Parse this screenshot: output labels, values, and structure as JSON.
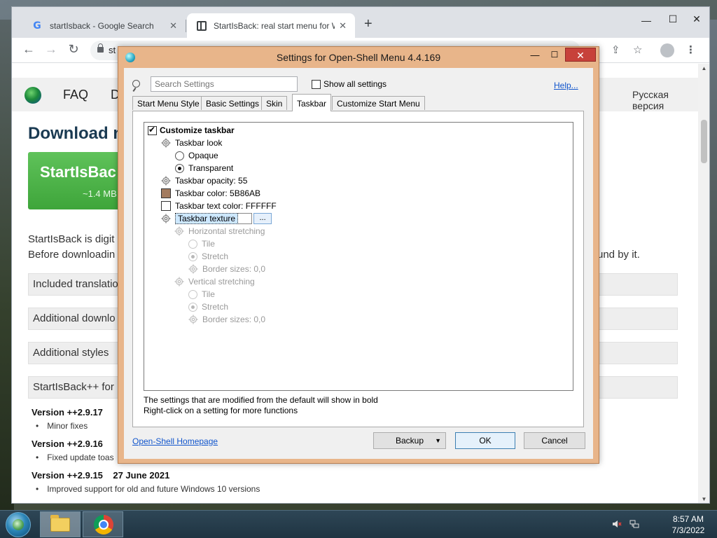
{
  "browser": {
    "tabs": [
      {
        "title": "startIsback - Google Search",
        "icon": "google-icon"
      },
      {
        "title": "StartIsBack: real start menu for W",
        "icon": "document-icon"
      }
    ],
    "omnibox_text": "st"
  },
  "website": {
    "nav_faq": "FAQ",
    "nav_d": "D",
    "language_link": "Русская версия",
    "heading": "Download n",
    "download_name": "StartIsBac",
    "download_size": "~1.4 MB",
    "para1": "StartIsBack is digit",
    "para2": "Before downloadin",
    "para2_tail": "und by it.",
    "accordions": [
      "Included translatio",
      "Additional downlo",
      "Additional styles",
      "StartIsBack++ for"
    ],
    "versions": [
      {
        "version": "Version ++2.9.17",
        "note": "Minor fixes"
      },
      {
        "version": "Version ++2.9.16",
        "note": "Fixed update toas"
      },
      {
        "version": "Version ++2.9.15    27 June 2021",
        "note": "Improved support for old and future Windows 10 versions"
      }
    ]
  },
  "dialog": {
    "title": "Settings for Open-Shell Menu 4.4.169",
    "search_placeholder": "Search Settings",
    "show_all_label": "Show all settings",
    "help_link": "Help...",
    "tabs": [
      "Start Menu Style",
      "Basic Settings",
      "Skin",
      "Taskbar",
      "Customize Start Menu"
    ],
    "active_tab": "Taskbar",
    "tree": {
      "customize": "Customize taskbar",
      "look": "Taskbar look",
      "opaque": "Opaque",
      "transparent": "Transparent",
      "opacity": "Taskbar opacity: 55",
      "color": "Taskbar color: 5B86AB",
      "text_color": "Taskbar text color: FFFFFF",
      "texture": "Taskbar texture",
      "texture_button": "...",
      "h_stretch": "Horizontal stretching",
      "h_tile": "Tile",
      "h_stretch_opt": "Stretch",
      "h_border": "Border sizes: 0,0",
      "v_stretch": "Vertical stretching",
      "v_tile": "Tile",
      "v_stretch_opt": "Stretch",
      "v_border": "Border sizes: 0,0"
    },
    "colors": {
      "taskbar_color": "#a37b5f",
      "text_color": "#FFFFFF"
    },
    "note1": "The settings that are modified from the default will show in bold",
    "note2": "Right-click on a setting for more functions",
    "homepage_link": "Open-Shell Homepage",
    "buttons": {
      "backup": "Backup",
      "ok": "OK",
      "cancel": "Cancel"
    }
  },
  "taskbar": {
    "time": "8:57 AM",
    "date": "7/3/2022"
  }
}
